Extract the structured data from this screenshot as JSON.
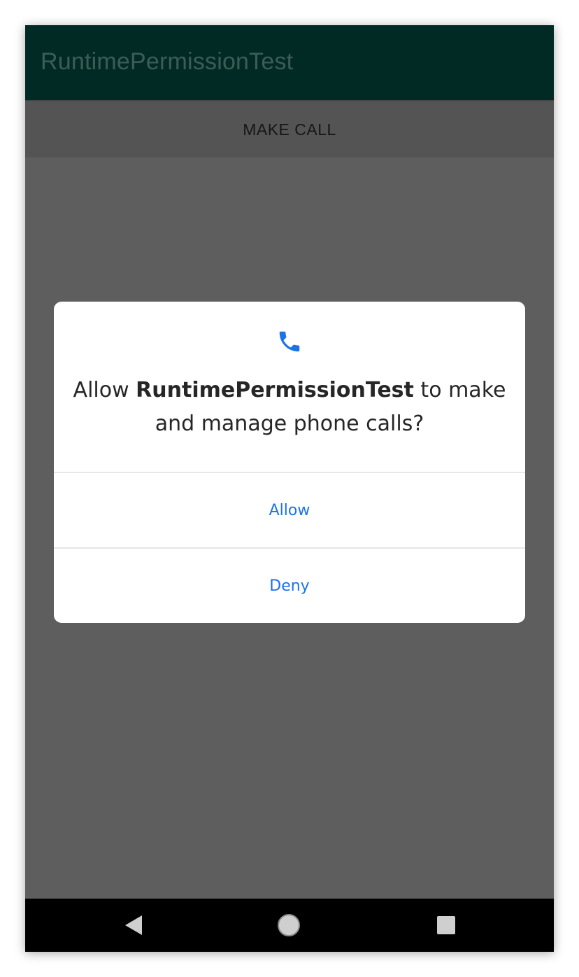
{
  "app_bar": {
    "title": "RuntimePermissionTest"
  },
  "main": {
    "make_call_label": "MAKE CALL"
  },
  "permission_dialog": {
    "icon": "phone-icon",
    "message_prefix": "Allow ",
    "app_name": "RuntimePermissionTest",
    "message_suffix": " to make and manage phone calls?",
    "allow_label": "Allow",
    "deny_label": "Deny"
  },
  "nav_bar": {
    "icons": [
      "back-icon",
      "home-icon",
      "recents-icon"
    ]
  },
  "colors": {
    "app_bar": "#022a25",
    "scrim_background": "#5e5e5e",
    "accent_blue": "#1a73e8",
    "nav_bar": "#000000"
  }
}
